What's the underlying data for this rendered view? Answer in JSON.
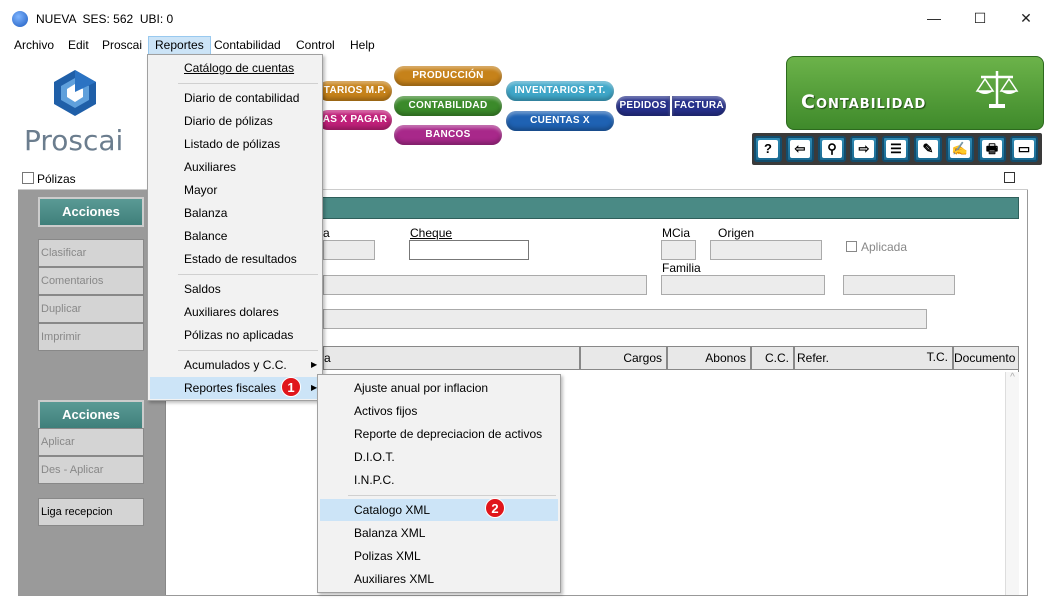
{
  "window": {
    "title": "NUEVA  SES: 562  UBI: 0",
    "minimize": "—",
    "maximize": "☐",
    "close": "✕"
  },
  "menubar": [
    "Archivo",
    "Edit",
    "Proscai",
    "Reportes",
    "Contabilidad",
    "Control",
    "Help"
  ],
  "toolbar": {
    "logo_text": "Proscai",
    "pills": {
      "inventarios_mp": "TARIOS M.P.",
      "produccion": "PRODUCCIÓN",
      "inventarios_pt": "INVENTARIOS P.T.",
      "cuentas_x_pagar": "AS X PAGAR",
      "contabilidad": "CONTABILIDAD",
      "cuentas_x_cobrar": "CUENTAS X COBRAR",
      "pedidos": "PEDIDOS",
      "factura": "FACTURA",
      "bancos": "BANCOS"
    },
    "module_title": "Contabilidad",
    "tools": [
      "?",
      "⇦",
      "⚲",
      "⇨",
      "☰",
      "✎",
      "✍",
      "🖶",
      "▭"
    ]
  },
  "polizas": {
    "title": "Pólizas",
    "acciones_1": "Acciones",
    "side_buttons_1": [
      "Clasificar",
      "Comentarios",
      "Duplicar",
      "Imprimir"
    ],
    "acciones_2": "Acciones",
    "side_buttons_2": [
      "Aplicar",
      "Des - Aplicar"
    ],
    "liga_recepcion": "Liga recepcion",
    "labels": {
      "fecha_frag": "a",
      "cheque": "Cheque",
      "mcia": "MCia",
      "origen": "Origen",
      "familia": "Familia",
      "aplicada": "Aplicada"
    },
    "grid_headers": {
      "col_frag": "a",
      "cargos": "Cargos",
      "abonos": "Abonos",
      "cc": "C.C.",
      "refer": "Refer.",
      "tc": "T.C.",
      "documento": "Documento"
    }
  },
  "reportes_menu": {
    "items": [
      "Catálogo de cuentas",
      "Diario de contabilidad",
      "Diario de pólizas",
      "Listado de pólizas",
      "Auxiliares",
      "Mayor",
      "Balanza",
      "Balance",
      "Estado de resultados",
      "Saldos",
      "Auxiliares dolares",
      "Pólizas no aplicadas",
      "Acumulados y C.C.",
      "Reportes fiscales"
    ]
  },
  "fiscales_menu": {
    "items": [
      "Ajuste anual por inflacion",
      "Activos fijos",
      "Reporte de depreciacion de activos",
      "D.I.O.T.",
      "I.N.P.C.",
      "Catalogo XML",
      "Balanza XML",
      "Polizas XML",
      "Auxiliares XML"
    ]
  },
  "badges": [
    "1",
    "2"
  ],
  "colors": {
    "menu_highlight": "#cce4f7",
    "section_header": "#4a8a85",
    "badge_red": "#e0151b",
    "module_green": "#5aa13f"
  }
}
